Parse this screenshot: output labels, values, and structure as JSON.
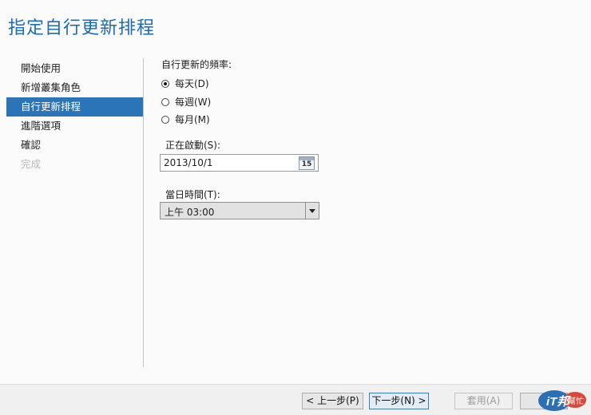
{
  "window": {
    "title": "指定自行更新排程"
  },
  "nav": {
    "items": [
      {
        "label": "開始使用",
        "state": "normal"
      },
      {
        "label": "新增叢集角色",
        "state": "normal"
      },
      {
        "label": "自行更新排程",
        "state": "selected"
      },
      {
        "label": "進階選項",
        "state": "normal"
      },
      {
        "label": "確認",
        "state": "normal"
      },
      {
        "label": "完成",
        "state": "disabled"
      }
    ]
  },
  "form": {
    "frequency_label": "自行更新的頻率:",
    "frequency_options": [
      {
        "label": "每天(D)",
        "checked": true
      },
      {
        "label": "每週(W)",
        "checked": false
      },
      {
        "label": "每月(M)",
        "checked": false
      }
    ],
    "start_label": "正在啟動(S):",
    "start_date": "2013/10/1",
    "calendar_icon": "calendar-icon",
    "calendar_icon_day": "15",
    "time_label": "當日時間(T):",
    "time_value": "上午 03:00"
  },
  "footer": {
    "prev_label": "< 上一步(P)",
    "next_label": "下一步(N) >",
    "apply_label": "套用(A)"
  },
  "watermark": {
    "text": "iT邦",
    "subtext": "幫忙"
  },
  "colors": {
    "accent": "#2b74b8",
    "title": "#1b6bb7"
  }
}
